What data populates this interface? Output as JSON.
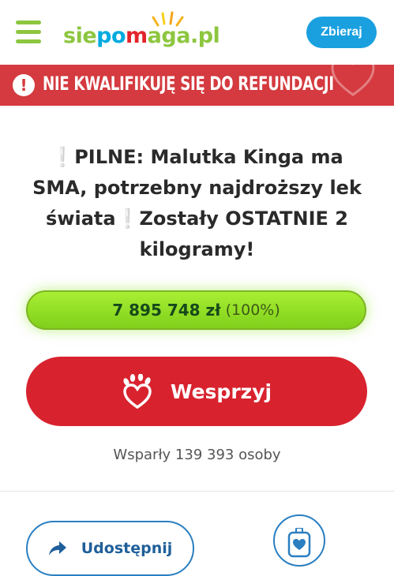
{
  "header": {
    "logo": {
      "part1": "sie",
      "part2": "po",
      "part3": "m",
      "part4": "aga.pl"
    },
    "collect_button": "Zbieraj"
  },
  "banner": {
    "text": "NIE KWALIFIKUJĘ SIĘ DO REFUNDACJI",
    "icon": "exclamation-icon"
  },
  "fundraiser": {
    "title": "❕PILNE: Malutka Kinga ma SMA, potrzebny najdroższy lek świata❕Zostały OSTATNIE 2 kilogramy!",
    "amount": "7 895 748 zł",
    "percent_label": "(100%)",
    "progress_fraction": 1.0,
    "support_button": "Wesprzyj",
    "supporters_text": "Wsparły 139 393 osoby"
  },
  "actions": {
    "share_button": "Udostępnij",
    "piggy_icon": "piggy-bank-icon"
  },
  "colors": {
    "brand_green": "#8dc63f",
    "brand_blue": "#1aa0df",
    "banner_red": "#d43a3f",
    "support_red": "#d8232f",
    "progress_green": "#8fdc24",
    "outline_blue": "#2a7fc1"
  }
}
